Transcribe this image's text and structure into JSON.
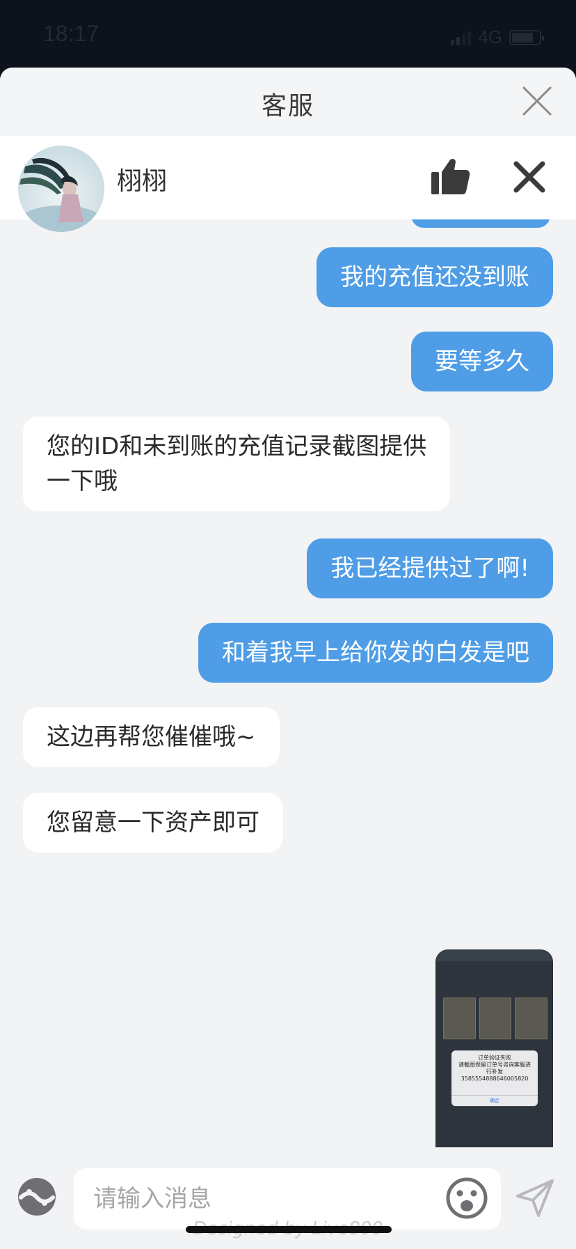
{
  "status_bar": {
    "time": "18:17",
    "network": "4G",
    "battery_level": 0.8
  },
  "header": {
    "title": "客服"
  },
  "agent": {
    "name": "栩栩"
  },
  "messages": [
    {
      "side": "out",
      "text": "我的充值还没到账"
    },
    {
      "side": "out",
      "text": "要等多久"
    },
    {
      "side": "in",
      "line1": "您的ID和未到账的充值记录截图提供",
      "line2": "一下哦"
    },
    {
      "side": "out",
      "text": "我已经提供过了啊!"
    },
    {
      "side": "out",
      "text": "和着我早上给你发的白发是吧"
    },
    {
      "side": "in",
      "text": "这边再帮您催催哦~"
    },
    {
      "side": "in",
      "text": "您留意一下资产即可"
    }
  ],
  "image_message": {
    "dialog_line1": "订单验证失败",
    "dialog_line2": "请截图保留订单号咨询客服进",
    "dialog_line3": "行补发",
    "dialog_line4": "3585554888646005820",
    "dialog_button": "确定"
  },
  "input": {
    "placeholder": "请输入消息"
  },
  "footer": {
    "designed_by": "Designed by Live800"
  },
  "colors": {
    "outgoing_bubble": "#4e9de6",
    "incoming_bubble": "#ffffff",
    "chat_background": "#f2f3f5"
  },
  "icons": {
    "close": "close-icon",
    "like": "thumbs-up-icon",
    "end": "x-icon",
    "voice": "voice-icon",
    "emoji": "emoji-icon",
    "send": "send-icon"
  }
}
